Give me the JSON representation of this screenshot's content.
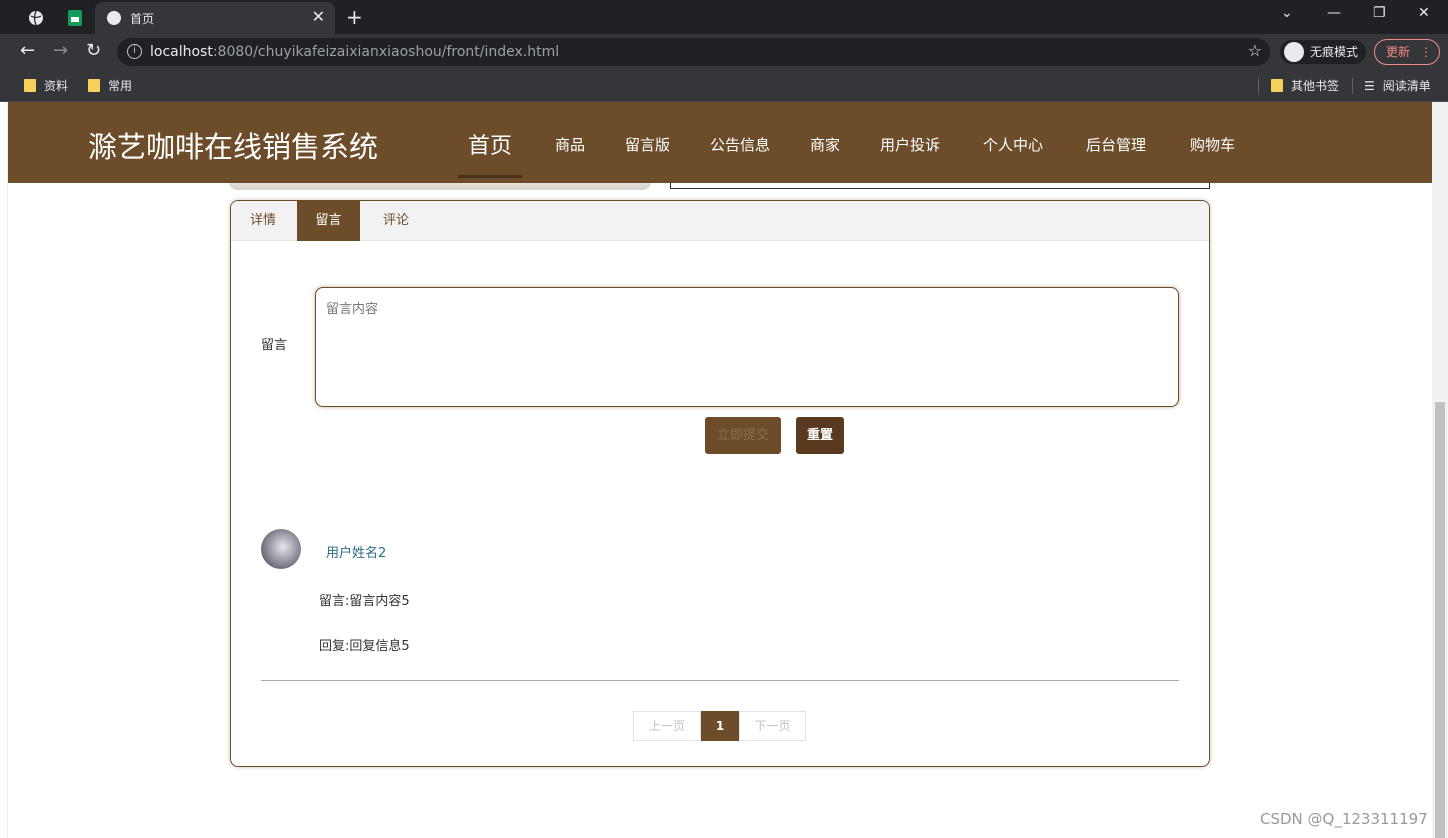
{
  "browser": {
    "tab_title": "首页",
    "url_host": "localhost",
    "url_rest": ":8080/chuyikafeizaixianxiaoshou/front/index.html",
    "incognito_label": "无痕模式",
    "update_label": "更新",
    "bookmarks": [
      "资料",
      "常用"
    ],
    "bookmarks_right": [
      "其他书签",
      "阅读清单"
    ]
  },
  "site": {
    "brand": "滁艺咖啡在线销售系统",
    "nav": [
      "首页",
      "商品",
      "留言版",
      "公告信息",
      "商家",
      "用户投诉",
      "个人中心",
      "后台管理",
      "购物车"
    ]
  },
  "detail_tabs": [
    "详情",
    "留言",
    "评论"
  ],
  "message_form": {
    "label": "留言",
    "placeholder": "留言内容",
    "submit": "立即提交",
    "reset": "重置"
  },
  "comments": [
    {
      "user": "用户姓名2",
      "message": "留言:留言内容5",
      "reply": "回复:回复信息5"
    }
  ],
  "pager": {
    "prev": "上一页",
    "current": "1",
    "next": "下一页"
  },
  "watermark": "CSDN @Q_123311197",
  "colors": {
    "accent": "#6d4c2a",
    "accent_dark": "#5a3a1e"
  }
}
